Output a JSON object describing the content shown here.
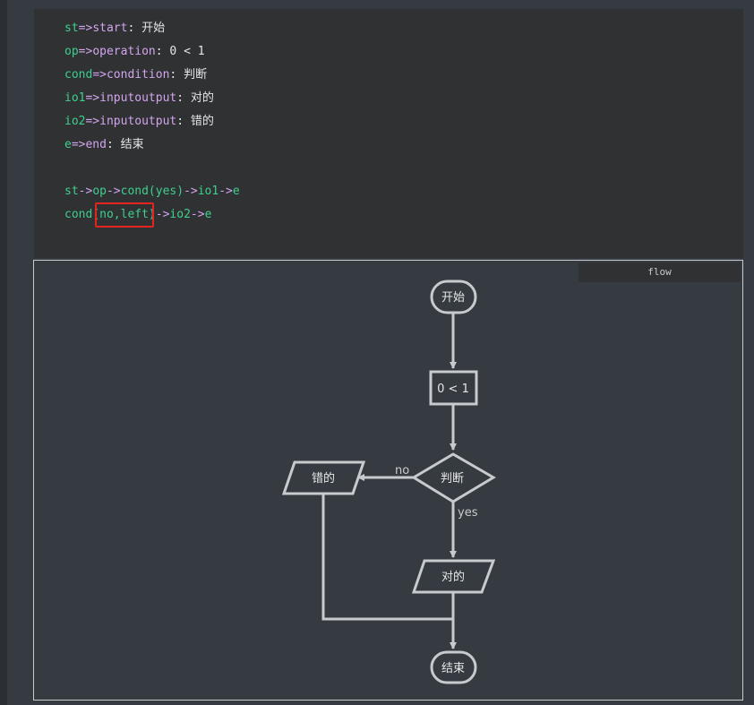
{
  "code": {
    "lines": [
      {
        "id": "st",
        "arrow": "=>",
        "type": "start",
        "label": "开始"
      },
      {
        "id": "op",
        "arrow": "=>",
        "type": "operation",
        "label": "0 < 1"
      },
      {
        "id": "cond",
        "arrow": "=>",
        "type": "condition",
        "label": "判断"
      },
      {
        "id": "io1",
        "arrow": "=>",
        "type": "inputoutput",
        "label": "对的"
      },
      {
        "id": "io2",
        "arrow": "=>",
        "type": "inputoutput",
        "label": "错的"
      },
      {
        "id": "e",
        "arrow": "=>",
        "type": "end",
        "label": "结束"
      }
    ],
    "flow1": {
      "st": "st",
      "a1": "->",
      "op": "op",
      "a2": "->",
      "cond": "cond(yes)",
      "a3": "->",
      "io1": "io1",
      "a4": "->",
      "e": "e"
    },
    "flow2": {
      "cond": "cond",
      "args": "(no,left)",
      "a1": "->",
      "io2": "io2",
      "a2": "->",
      "e": "e"
    }
  },
  "language_label": "flow",
  "diagram": {
    "start": "开始",
    "operation": "0 < 1",
    "condition": "判断",
    "yes_label": "yes",
    "no_label": "no",
    "io_yes": "对的",
    "io_no": "错的",
    "end": "结束"
  },
  "colors": {
    "background": "#363b41",
    "code_background": "#2f3133",
    "identifier": "#3fcf8e",
    "keyword": "#d3a5ee",
    "diagram_stroke": "#c8cbcd",
    "highlight": "#e3251d"
  }
}
